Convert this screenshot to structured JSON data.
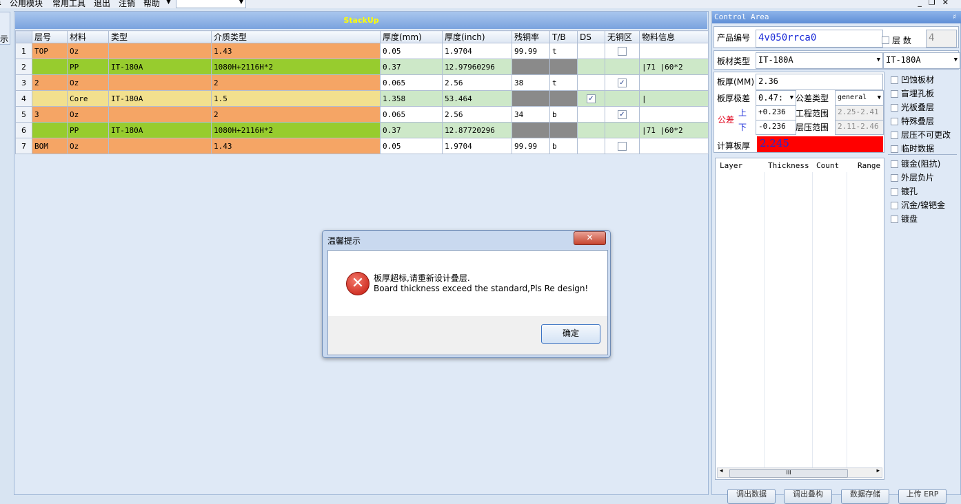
{
  "menubar": {
    "items": [
      "公用模块",
      "常用工具",
      "退出",
      "注销",
      "帮助"
    ],
    "combo_value": ""
  },
  "left_tab": {
    "label": "示"
  },
  "stackup": {
    "title": "StackUp",
    "columns": [
      "层号",
      "材料",
      "类型",
      "介质类型",
      "厚度(mm)",
      "厚度(inch)",
      "残铜率",
      "T/B",
      "DS",
      "无铜区",
      "物料信息"
    ],
    "rows": [
      {
        "n": "1",
        "layer": "TOP",
        "mat": "Oz",
        "type": "",
        "dielectric": "1.43",
        "mm": "0.05",
        "inch": "1.9704",
        "copper": "99.99",
        "tb": "t",
        "ds": false,
        "nocopper": false,
        "material_info": ""
      },
      {
        "n": "2",
        "layer": "",
        "mat": "PP",
        "type": "IT-180A",
        "dielectric": "1080H+2116H*2",
        "mm": "0.37",
        "inch": "12.97960296",
        "copper": "",
        "tb": "",
        "ds": null,
        "nocopper": null,
        "material_info": "|71 |60*2"
      },
      {
        "n": "3",
        "layer": "2",
        "mat": "Oz",
        "type": "",
        "dielectric": "2",
        "mm": "0.065",
        "inch": "2.56",
        "copper": "38",
        "tb": "t",
        "ds": false,
        "nocopper": true,
        "material_info": ""
      },
      {
        "n": "4",
        "layer": "",
        "mat": "Core",
        "type": "IT-180A",
        "dielectric": "1.5",
        "mm": "1.358",
        "inch": "53.464",
        "copper": "",
        "tb": "",
        "ds": true,
        "nocopper": null,
        "material_info": "|"
      },
      {
        "n": "5",
        "layer": "3",
        "mat": "Oz",
        "type": "",
        "dielectric": "2",
        "mm": "0.065",
        "inch": "2.56",
        "copper": "34",
        "tb": "b",
        "ds": false,
        "nocopper": true,
        "material_info": ""
      },
      {
        "n": "6",
        "layer": "",
        "mat": "PP",
        "type": "IT-180A",
        "dielectric": "1080H+2116H*2",
        "mm": "0.37",
        "inch": "12.87720296",
        "copper": "",
        "tb": "",
        "ds": null,
        "nocopper": null,
        "material_info": "|71 |60*2"
      },
      {
        "n": "7",
        "layer": "BOM",
        "mat": "Oz",
        "type": "",
        "dielectric": "1.43",
        "mm": "0.05",
        "inch": "1.9704",
        "copper": "99.99",
        "tb": "b",
        "ds": false,
        "nocopper": false,
        "material_info": ""
      }
    ]
  },
  "dialog": {
    "title": "温馨提示",
    "close_label": "✕",
    "message_cn": "板厚超标,请重新设计叠层.",
    "message_en": "Board thickness exceed the standard,Pls Re design!",
    "ok_label": "确定"
  },
  "control": {
    "title": "Control Area",
    "pin": "♯",
    "product_no_label": "产品编号",
    "product_no": "4v050rrca0",
    "layers_label": "层  数",
    "layers": "4",
    "board_type_label": "板材类型",
    "board_type": "IT-180A",
    "board_type2": "IT-180A",
    "thickness_label": "板厚(MM)",
    "thickness": "2.36",
    "tol_level_label": "板厚极差",
    "tol_level": "0.47:",
    "tol_type_label": "公差类型",
    "tol_type": "general",
    "tol_label": "公差",
    "upper_label": "上",
    "lower_label": "下",
    "upper": "+0.236",
    "lower": "-0.236",
    "eng_range_label": "工程范围",
    "eng_range": "2.25-2.41",
    "press_range_label": "层压范围",
    "press_range": "2.11-2.46",
    "calc_label": "计算板厚",
    "calc_value": "2.245",
    "options_a": [
      "凹蚀板材",
      "盲埋孔板",
      "光板叠层",
      "特殊叠层",
      "层压不可更改",
      "临时数据"
    ],
    "options_b": [
      "镀金(阻抗)",
      "外层负片",
      "镀孔",
      "沉金/镍钯金",
      "镀盘"
    ],
    "layer_table_cols": [
      "Layer",
      "Thickness",
      "Count",
      "Range"
    ],
    "scroll_thumb": "III",
    "bottom_buttons": [
      "调出数据",
      "调出叠构",
      "数据存储",
      "上传 ERP"
    ],
    "colors": {
      "calc_bg": "#ff0000",
      "calc_fg": "#1a2bd8",
      "tol_red": "#e0001a"
    }
  }
}
